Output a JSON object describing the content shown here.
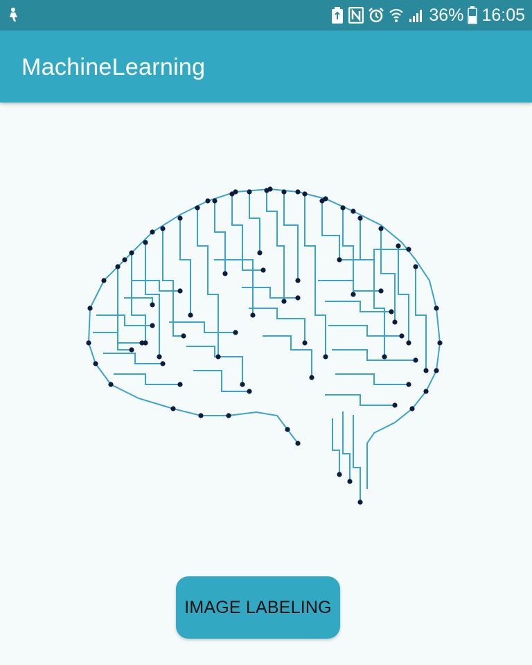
{
  "status_bar": {
    "battery_percent": "36%",
    "time": "16:05",
    "icons": [
      "notification-icon",
      "battery-saver-icon",
      "nfc-icon",
      "alarm-icon",
      "wifi-icon",
      "signal-icon",
      "battery-icon"
    ]
  },
  "app_bar": {
    "title": "MachineLearning"
  },
  "illustration": {
    "icon": "circuit-brain-icon",
    "line_color": "#3aa3c8",
    "node_color": "#0d1b3e"
  },
  "main": {
    "button_label": "IMAGE LABELING"
  },
  "colors": {
    "status_bar": "#2a8a9c",
    "app_bar": "#33a8c3",
    "background": "#f5fafb",
    "button": "#33a8c3"
  }
}
